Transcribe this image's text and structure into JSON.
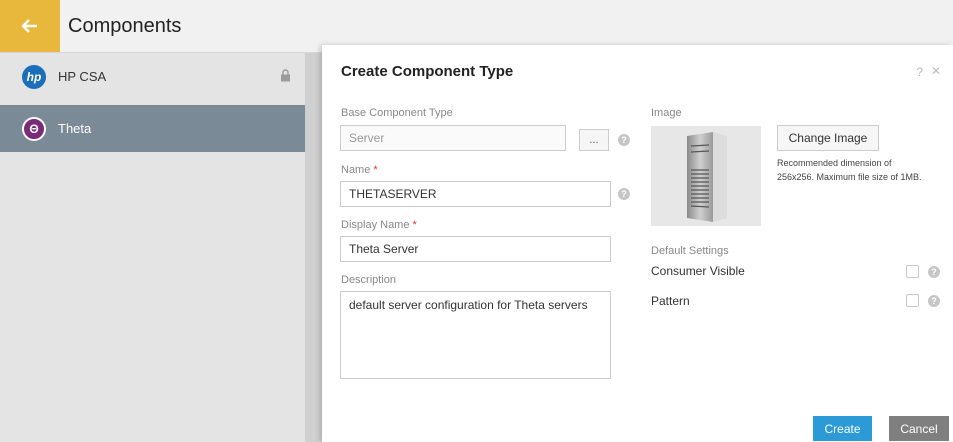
{
  "header": {
    "title": "Components"
  },
  "sidebar": {
    "providers": [
      {
        "name": "HP CSA",
        "logo_text": "hp",
        "locked": true
      },
      {
        "name": "Theta",
        "logo_text": "Θ",
        "active": true
      }
    ]
  },
  "dialog": {
    "title": "Create Component Type",
    "help": "?",
    "close": "✕",
    "base_type": {
      "label": "Base Component Type",
      "value": "Server",
      "browse_label": "..."
    },
    "name": {
      "label": "Name",
      "required_mark": "*",
      "value": "THETASERVER"
    },
    "display_name": {
      "label": "Display Name",
      "required_mark": "*",
      "value": "Theta Server"
    },
    "description": {
      "label": "Description",
      "value": "default server configuration for Theta servers"
    },
    "image": {
      "label": "Image",
      "change_button": "Change Image",
      "hint": "Recommended dimension of 256x256. Maximum file size of 1MB."
    },
    "default_settings": {
      "label": "Default Settings",
      "consumer_visible": {
        "label": "Consumer Visible",
        "checked": false
      },
      "pattern": {
        "label": "Pattern",
        "checked": false
      }
    },
    "create_button": "Create",
    "cancel_button": "Cancel"
  },
  "colors": {
    "accent": "#e8b83c",
    "primary": "#2c9ad6",
    "active_row": "#7b8a97",
    "hp_blue": "#1a6fb8",
    "theta_purple": "#7a2a76"
  }
}
